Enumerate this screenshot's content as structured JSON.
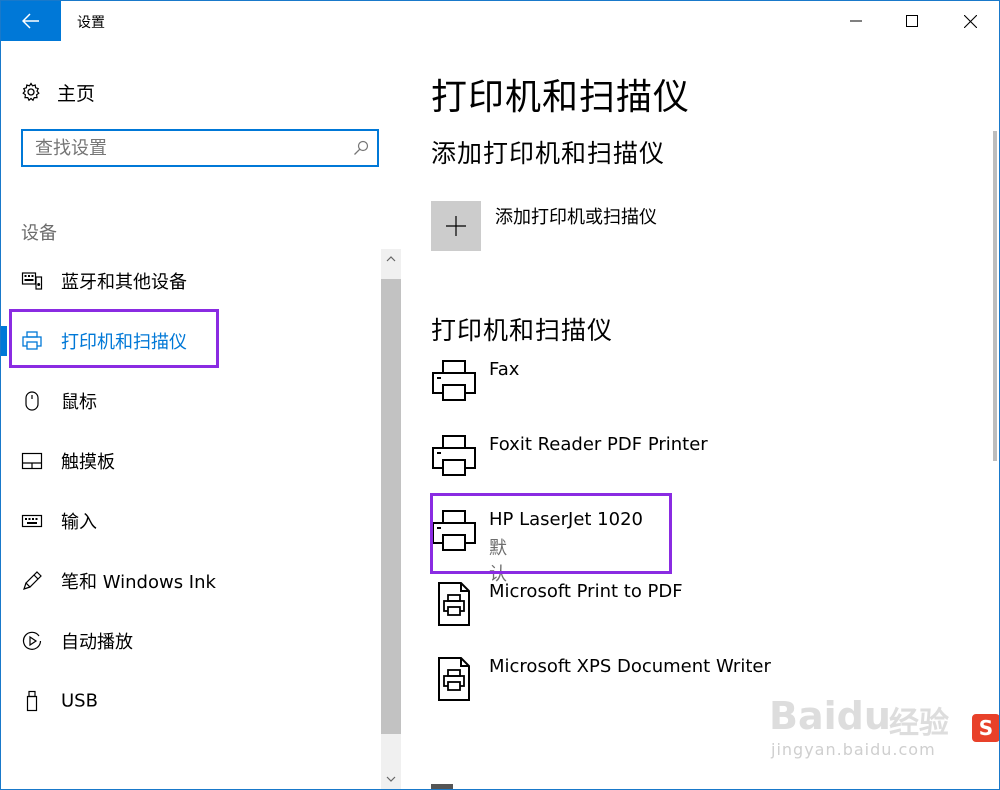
{
  "window": {
    "title": "设置",
    "icons": {
      "back": "arrow-left-icon",
      "minimize": "minimize-icon",
      "maximize": "maximize-icon",
      "close": "close-icon"
    }
  },
  "sidebar": {
    "home_label": "主页",
    "search": {
      "placeholder": "查找设置",
      "value": ""
    },
    "section_label": "设备",
    "items": [
      {
        "label": "蓝牙和其他设备",
        "icon": "bluetooth-devices-icon",
        "active": false
      },
      {
        "label": "打印机和扫描仪",
        "icon": "printer-icon",
        "active": true
      },
      {
        "label": "鼠标",
        "icon": "mouse-icon",
        "active": false
      },
      {
        "label": "触摸板",
        "icon": "touchpad-icon",
        "active": false
      },
      {
        "label": "输入",
        "icon": "keyboard-icon",
        "active": false
      },
      {
        "label": "笔和 Windows Ink",
        "icon": "pen-icon",
        "active": false
      },
      {
        "label": "自动播放",
        "icon": "autoplay-icon",
        "active": false
      },
      {
        "label": "USB",
        "icon": "usb-icon",
        "active": false
      }
    ]
  },
  "main": {
    "page_title": "打印机和扫描仪",
    "add_section_title": "添加打印机和扫描仪",
    "add_label": "添加打印机或扫描仪",
    "list_section_title": "打印机和扫描仪",
    "printers": [
      {
        "name": "Fax",
        "status": "",
        "icon": "printer-icon"
      },
      {
        "name": "Foxit Reader PDF Printer",
        "status": "",
        "icon": "printer-icon"
      },
      {
        "name": "HP LaserJet 1020",
        "status": "默认",
        "icon": "printer-icon"
      },
      {
        "name": "Microsoft Print to PDF",
        "status": "",
        "icon": "document-printer-icon"
      },
      {
        "name": "Microsoft XPS Document Writer",
        "status": "",
        "icon": "document-printer-icon"
      }
    ]
  },
  "watermark": {
    "brand": "Baidu",
    "brand_cn": "经验",
    "url": "jingyan.baidu.com"
  },
  "colors": {
    "accent": "#0078d7",
    "highlight": "#8a2be2",
    "tile": "#cccccc"
  }
}
